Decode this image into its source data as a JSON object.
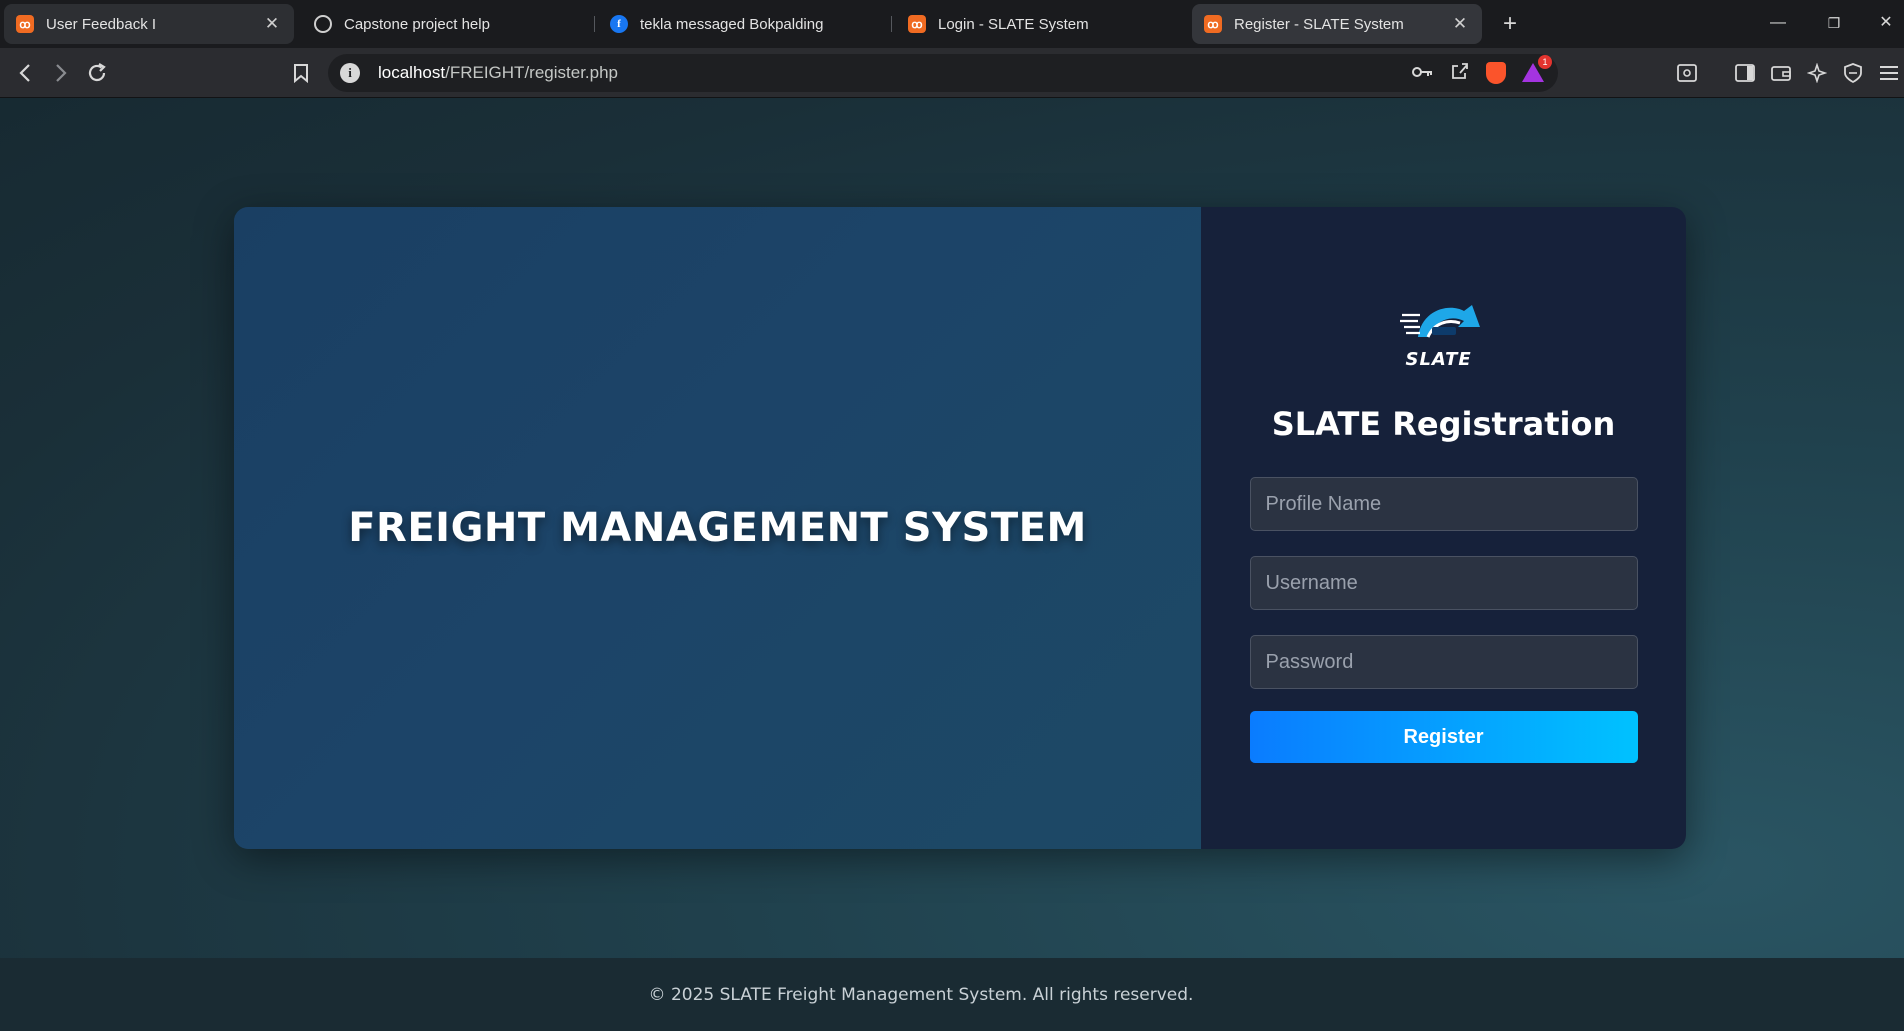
{
  "browser": {
    "tabs": [
      {
        "title": "User Feedback I",
        "favicon": "xampp-icon"
      },
      {
        "title": "Capstone project help",
        "favicon": "chatgpt-icon"
      },
      {
        "title": "tekla messaged Bokpalding",
        "favicon": "facebook-icon"
      },
      {
        "title": "Login - SLATE System",
        "favicon": "xampp-icon"
      },
      {
        "title": "Register - SLATE System",
        "favicon": "xampp-icon"
      }
    ],
    "url": {
      "host": "localhost",
      "path": "/FREIGHT/register.php"
    },
    "rewards_badge": "1"
  },
  "hero": {
    "title": "FREIGHT MANAGEMENT SYSTEM"
  },
  "register": {
    "logo_text": "SLATE",
    "title": "SLATE Registration",
    "profile_name_placeholder": "Profile Name",
    "username_placeholder": "Username",
    "password_placeholder": "Password",
    "submit_label": "Register"
  },
  "footer": {
    "text": "© 2025 SLATE Freight Management System. All rights reserved."
  },
  "colors": {
    "accent_start": "#0a7cff",
    "accent_end": "#00c2ff",
    "panel_dark": "#16213a",
    "panel_blue": "#1c4468"
  }
}
